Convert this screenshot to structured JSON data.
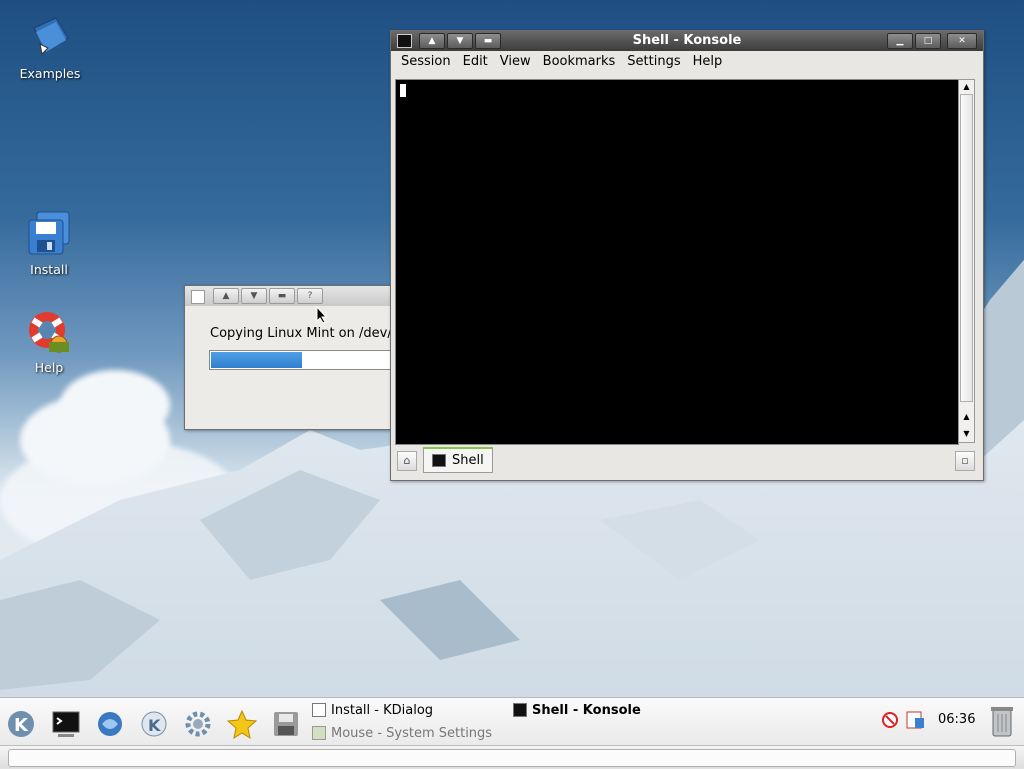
{
  "desktop": {
    "icons": [
      {
        "label": "Examples",
        "icon": "folder-book-icon"
      },
      {
        "label": "Install",
        "icon": "floppy-install-icon"
      },
      {
        "label": "Help",
        "icon": "lifebuoy-help-icon"
      }
    ]
  },
  "konsole": {
    "title": "Shell - Konsole",
    "menu": [
      "Session",
      "Edit",
      "View",
      "Bookmarks",
      "Settings",
      "Help"
    ],
    "tab_label": "Shell"
  },
  "dialog": {
    "message": "Copying Linux Mint on /dev/hd",
    "progress_percent": 46
  },
  "taskbar": {
    "tasks": [
      {
        "label": "Install - KDialog",
        "active": false
      },
      {
        "label": "Shell - Konsole",
        "active": true
      },
      {
        "label": "Mouse - System Settings",
        "active": false
      }
    ],
    "clock": "06:36"
  },
  "colors": {
    "titlebar_active": "#3c3c3c",
    "progress_fill": "#2f7fd0",
    "tab_accent": "#8bc34a"
  }
}
